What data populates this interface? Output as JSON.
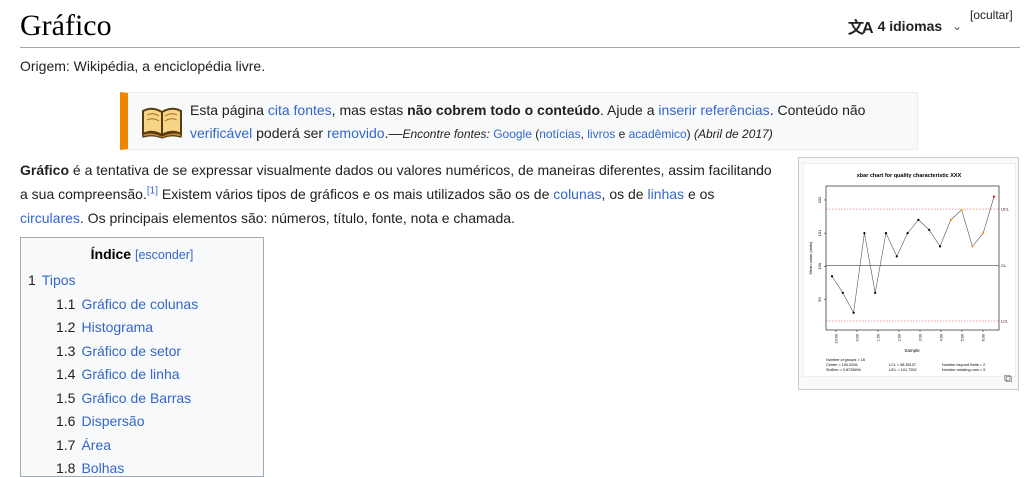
{
  "header": {
    "title": "Gráfico",
    "lang_icon": "translate-icon",
    "languages": "4 idiomas",
    "hide": "[ocultar]"
  },
  "origin": "Origem: Wikipédia, a enciclopédia livre.",
  "ambox": {
    "icon": "book-icon",
    "t1": "Esta página ",
    "l_cita": "cita fontes",
    "t2": ", mas estas ",
    "b1": "não cobrem todo o conteúdo",
    "t3": ". Ajude a ",
    "l_inserir": "inserir referências",
    "t4": ". Conteúdo não ",
    "l_verif": "verificável",
    "t5": " poderá ser ",
    "l_removido": "removido",
    "t6": ".—",
    "enc": "Encontre fontes:",
    "l_google": "Google",
    "t7": " (",
    "l_noticias": "notícias",
    "t8": ", ",
    "l_livros": "livros",
    "t9": " e ",
    "l_academico": "acadêmico",
    "t10": ")",
    "date": "(Abril de 2017)"
  },
  "paragraph": {
    "bold": "Gráfico",
    "p1": " é a tentativa de se expressar visualmente dados ou valores numéricos, de maneiras diferentes, assim facilitando a sua compreensão.",
    "ref": "[1]",
    "p2": " Existem vários tipos de gráficos e os mais utilizados são os de ",
    "l_colunas": "colunas",
    "p3": ", os de ",
    "l_linhas": "linhas",
    "p4": " e os ",
    "l_circulares": "circulares",
    "p5": ". Os principais elementos são: números, título, fonte, nota e chamada."
  },
  "toc": {
    "title": "Índice",
    "hide": "[esconder]",
    "items": [
      {
        "num": "1",
        "label": "Tipos"
      },
      {
        "num": "1.1",
        "label": "Gráfico de colunas"
      },
      {
        "num": "1.2",
        "label": "Histograma"
      },
      {
        "num": "1.3",
        "label": "Gráfico de setor"
      },
      {
        "num": "1.4",
        "label": "Gráfico de linha"
      },
      {
        "num": "1.5",
        "label": "Gráfico de Barras"
      },
      {
        "num": "1.6",
        "label": "Dispersão"
      },
      {
        "num": "1.7",
        "label": "Área"
      },
      {
        "num": "1.8",
        "label": "Bolhas"
      }
    ]
  },
  "thumb": {
    "chart_title": "xbar chart for quality characteristic XXX",
    "ylabel": "Mean value (units)",
    "xlabel": "Sample",
    "ucl": "UCL",
    "cl": "CL",
    "lcl": "LCL",
    "yticks": [
      "102",
      "101",
      "100",
      "99"
    ],
    "xticks": [
      "23:00",
      "0:00",
      "1:00",
      "2:00",
      "3:00",
      "4:00",
      "5:00",
      "6:00"
    ],
    "stats1": "Number of groups = 16",
    "stats2": "Center = 100.0206",
    "stats3": "StdDev = 0.8725694",
    "stats4": "LCL = 98.35137",
    "stats5": "UCL = 101.7252",
    "stats6": "Number beyond limits = 2",
    "stats7": "Number violating runs = 5",
    "enlarge_icon": "enlarge-icon"
  },
  "chart_data": {
    "type": "line",
    "title": "xbar chart for quality characteristic XXX",
    "xlabel": "Sample",
    "ylabel": "Mean value (units)",
    "ylim": [
      98.2,
      102.3
    ],
    "center": 100.0206,
    "ucl": 101.7252,
    "lcl": 98.35137,
    "values": [
      99.7,
      99.2,
      98.6,
      101.0,
      99.2,
      101.0,
      100.3,
      101.0,
      101.4,
      101.1,
      100.6,
      101.4,
      101.7,
      100.6,
      101.0,
      102.1
    ]
  }
}
